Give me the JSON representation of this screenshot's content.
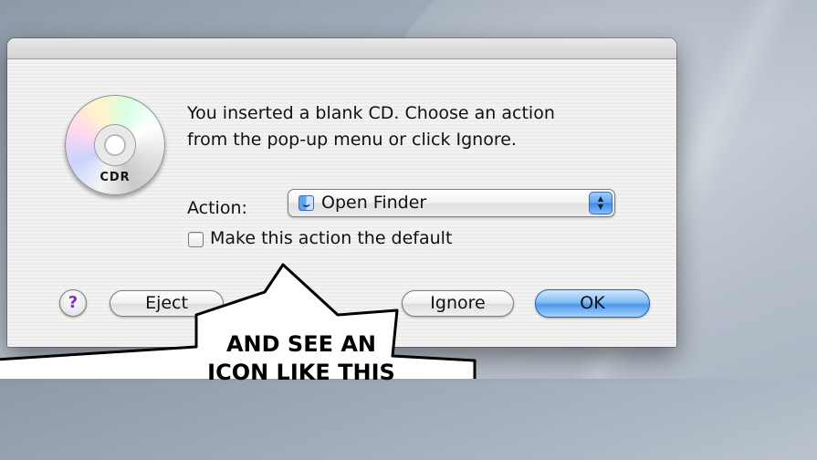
{
  "dialog": {
    "icon": {
      "name": "cd-r-icon",
      "label": "CDR"
    },
    "message": {
      "line1": "You inserted a blank CD. Choose an action",
      "line2": "from the pop-up menu or click Ignore."
    },
    "action": {
      "label": "Action:",
      "value": "Open Finder",
      "value_icon": "finder-icon"
    },
    "checkbox": {
      "label": "Make this action the default",
      "checked": false
    },
    "buttons": {
      "help": "?",
      "eject": "Eject",
      "ignore": "Ignore",
      "ok": "OK"
    }
  },
  "annotation": {
    "line1": "AND SEE AN",
    "line2": "ICON LIKE THIS"
  }
}
